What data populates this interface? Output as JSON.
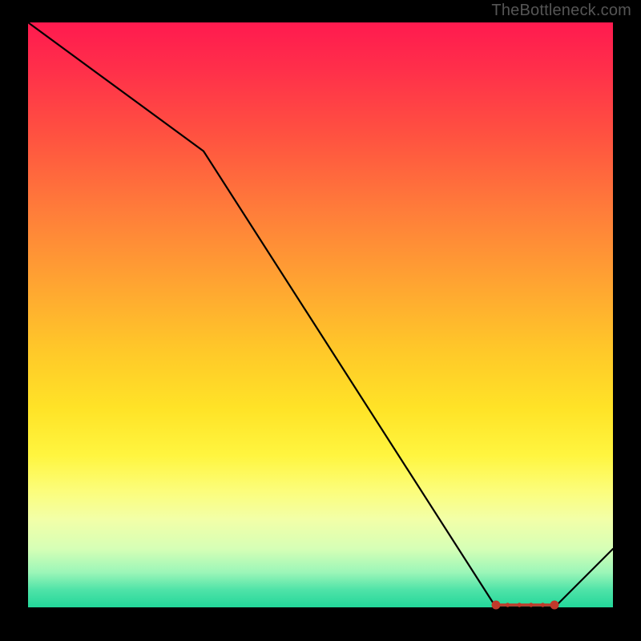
{
  "attribution": "TheBottleneck.com",
  "chart_data": {
    "type": "line",
    "title": "",
    "xlabel": "",
    "ylabel": "",
    "xlim": [
      0,
      100
    ],
    "ylim": [
      0,
      100
    ],
    "grid": false,
    "legend": false,
    "x": [
      0,
      30,
      80,
      90,
      100
    ],
    "values": [
      100,
      78,
      0,
      0,
      10
    ],
    "marker_region": {
      "start_x": 80,
      "end_x": 90,
      "y": 0
    },
    "colors": {
      "top": "#ff1a4f",
      "mid": "#ffe327",
      "bottom": "#22d79a",
      "line": "#000000",
      "marker": "#c0392b"
    }
  }
}
